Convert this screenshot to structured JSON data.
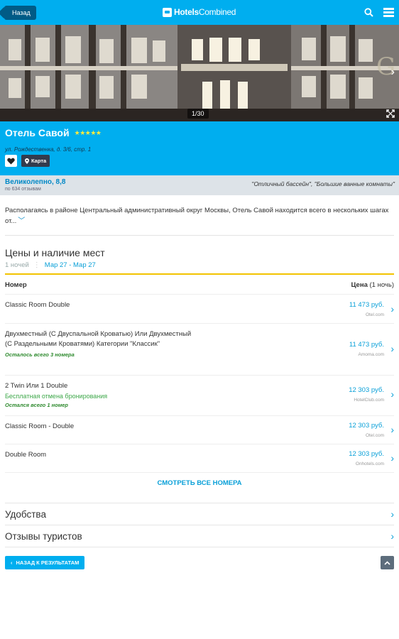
{
  "header": {
    "back_label": "Назад",
    "logo_bold": "Hotels",
    "logo_rest": "Combined"
  },
  "photo": {
    "counter": "1/30"
  },
  "hotel": {
    "name": "Отель Савой",
    "stars": "★★★★★",
    "address": "ул. Рождественка, д. 3/6, стр. 1",
    "map_label": "Карта"
  },
  "rating": {
    "score": "Великолепно, 8,8",
    "count": "по 634 отзывам",
    "quote": "\"Отличный бассейн\", \"Большие ванные комнаты\""
  },
  "description": {
    "text": "Располагаясь в районе Центральный административный округ Москвы, Отель Савой находится всего в нескольких шагах от..."
  },
  "prices": {
    "title": "Цены и наличие мест",
    "nights": "1 ночей",
    "dates": "Мар 27 - Мар 27",
    "col_room": "Номер",
    "col_price": "Цена",
    "col_price_per": "(1 ночь)",
    "rooms": [
      {
        "name": "Classic Room Double",
        "price": "11 473 руб.",
        "vendor": "Otel.com",
        "note_green": "",
        "note_warn": ""
      },
      {
        "name": "Двухместный (С Двуспальной Кроватью) Или Двухместный (С Раздельными Кроватями) Категории \"Классик\"",
        "price": "11 473 руб.",
        "vendor": "Amoma.com",
        "note_green": "",
        "note_warn": "Осталось всего 3 номера"
      },
      {
        "name": "2 Twin Или 1 Double",
        "price": "12 303 руб.",
        "vendor": "HotelClub.com",
        "note_green": "Бесплатная отмена бронирования",
        "note_warn": "Остался всего 1 номер"
      },
      {
        "name": "Classic Room - Double",
        "price": "12 303 руб.",
        "vendor": "Otel.com",
        "note_green": "",
        "note_warn": ""
      },
      {
        "name": "Double Room",
        "price": "12 303 руб.",
        "vendor": "Onhotels.com",
        "note_green": "",
        "note_warn": ""
      }
    ],
    "see_all": "СМОТРЕТЬ ВСЕ НОМЕРА"
  },
  "sections": {
    "amenities": "Удобства",
    "reviews": "Отзывы туристов"
  },
  "footer": {
    "back_to_results": "НАЗАД К РЕЗУЛЬТАТАМ"
  },
  "colors": {
    "brand": "#00aeef",
    "dark_button": "#005b86",
    "accent_underline": "#f2c300",
    "green": "#3ea84a"
  }
}
